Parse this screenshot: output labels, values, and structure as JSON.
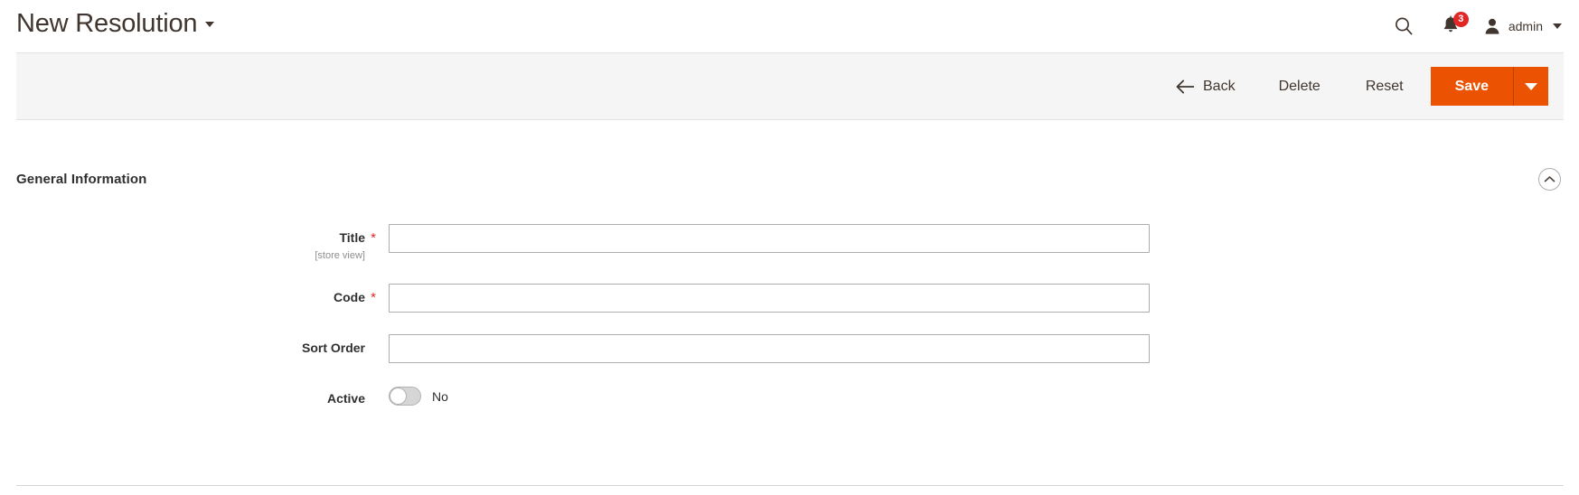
{
  "header": {
    "title": "New Resolution",
    "title_caret_icon": "chevron-down-icon",
    "search_icon": "search-icon",
    "notifications_icon": "bell-icon",
    "notifications_count": "3",
    "avatar_icon": "user-icon",
    "user_name": "admin",
    "user_caret_icon": "chevron-down-icon"
  },
  "toolbar": {
    "back_icon": "arrow-left-icon",
    "back_label": "Back",
    "delete_label": "Delete",
    "reset_label": "Reset",
    "save_label": "Save",
    "save_caret_icon": "chevron-down-icon",
    "accent_color": "#eb5202"
  },
  "section": {
    "title": "General Information",
    "collapse_icon": "chevron-up-circle-icon"
  },
  "form": {
    "fields": [
      {
        "label": "Title",
        "required": "*",
        "scope": "[store view]",
        "value": "",
        "placeholder": ""
      },
      {
        "label": "Code",
        "required": "*",
        "scope": "",
        "value": "",
        "placeholder": ""
      },
      {
        "label": "Sort Order",
        "required": "",
        "scope": "",
        "value": "",
        "placeholder": ""
      }
    ],
    "active": {
      "label": "Active",
      "state_label": "No",
      "checked": false
    }
  }
}
